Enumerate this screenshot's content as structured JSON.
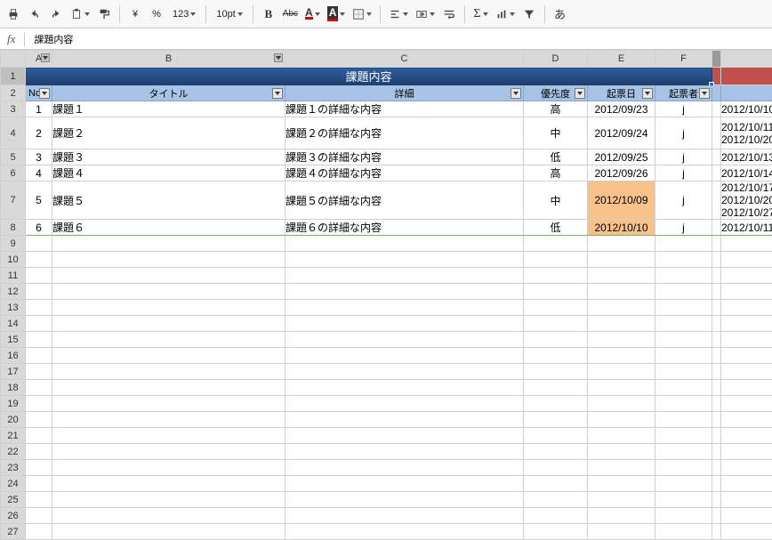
{
  "toolbar": {
    "currency": "¥",
    "percent": "%",
    "numfmt": "123",
    "fontsize": "10pt",
    "strike_label": "Abc",
    "font_A": "A",
    "fill_A": "A",
    "sigma": "Σ",
    "ja_a": "あ"
  },
  "fx": {
    "label": "fx",
    "value": "課題内容"
  },
  "columns": [
    "A",
    "B",
    "C",
    "D",
    "E",
    "F"
  ],
  "row_numbers": [
    1,
    2,
    3,
    4,
    5,
    6,
    7,
    8,
    9,
    10,
    11,
    12,
    13,
    14,
    15,
    16,
    17,
    18,
    19,
    20,
    21,
    22,
    23,
    24,
    25,
    26,
    27
  ],
  "title_row": "課題内容",
  "filter_headers": {
    "no": "No",
    "title": "タイトル",
    "detail": "詳細",
    "priority": "優先度",
    "created": "起票日",
    "creator": "起票者"
  },
  "rows": [
    {
      "no": "1",
      "title": "課題１",
      "detail": "課題１の詳細な内容",
      "priority": "高",
      "created": "2012/09/23",
      "creator": "j",
      "edge": [
        "2012/10/10"
      ],
      "hl_created": false
    },
    {
      "no": "2",
      "title": "課題２",
      "detail": "課題２の詳細な内容",
      "priority": "中",
      "created": "2012/09/24",
      "creator": "j",
      "edge": [
        "2012/10/11",
        "2012/10/20"
      ],
      "hl_created": false,
      "tall": true
    },
    {
      "no": "3",
      "title": "課題３",
      "detail": "課題３の詳細な内容",
      "priority": "低",
      "created": "2012/09/25",
      "creator": "j",
      "edge": [
        "2012/10/13"
      ],
      "hl_created": false
    },
    {
      "no": "4",
      "title": "課題４",
      "detail": "課題４の詳細な内容",
      "priority": "高",
      "created": "2012/09/26",
      "creator": "j",
      "edge": [
        "2012/10/14"
      ],
      "hl_created": false
    },
    {
      "no": "5",
      "title": "課題５",
      "detail": "課題５の詳細な内容",
      "priority": "中",
      "created": "2012/10/09",
      "creator": "j",
      "edge": [
        "2012/10/17",
        "2012/10/20",
        "2012/10/27"
      ],
      "hl_created": true,
      "tall": true
    },
    {
      "no": "6",
      "title": "課題６",
      "detail": "課題６の詳細な内容",
      "priority": "低",
      "created": "2012/10/10",
      "creator": "j",
      "edge": [
        "2012/10/11"
      ],
      "hl_created": true
    }
  ]
}
